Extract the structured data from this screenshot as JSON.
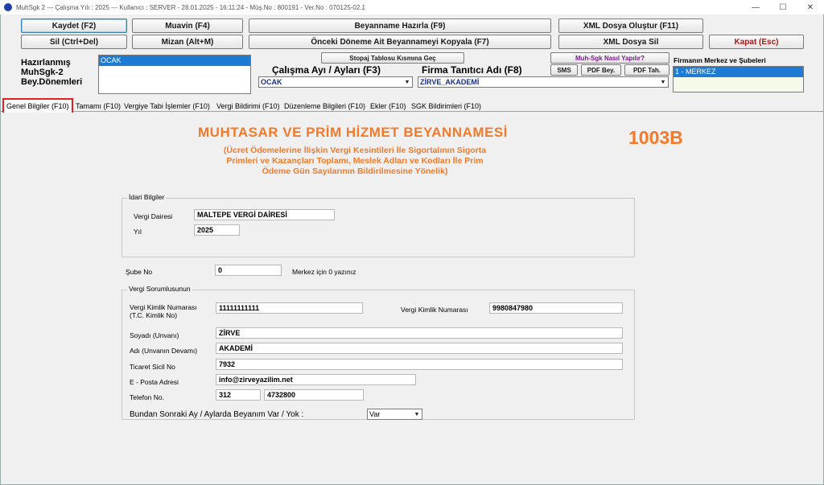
{
  "window": {
    "title": "MuhSgk 2  ---  Çalışma Yılı : 2025  ---  Kullanıcı : SERVER - 28.01.2025 - 16:11:24 - Müş.No : 800191 - Ver.No : 070125-02.1"
  },
  "toolbar": {
    "kaydet": "Kaydet (F2)",
    "muavin": "Muavin (F4)",
    "beyanname_hazirla": "Beyanname Hazırla (F9)",
    "xml_olustur": "XML Dosya Oluştur (F11)",
    "sil": "Sil (Ctrl+Del)",
    "mizan": "Mizan (Alt+M)",
    "onceki_kopyala": "Önceki Döneme Ait Beyannameyi Kopyala (F7)",
    "xml_sil": "XML Dosya Sil",
    "kapat": "Kapat (Esc)",
    "stopaj": "Stopaj Tablosu Kısmına Geç",
    "muh_sgk": "Muh-Sgk Nasıl Yapılır?",
    "sms": "SMS",
    "pdf_bey": "PDF Bey.",
    "pdf_tah": "PDF Tah."
  },
  "left": {
    "line1": "Hazırlanmış",
    "line2": "MuhSgk-2",
    "line3": "Bey.Dönemleri",
    "period_selected": "OCAK"
  },
  "calisma": {
    "label": "Çalışma Ayı / Ayları (F3)",
    "value": "OCAK"
  },
  "firma": {
    "label": "Firma Tanıtıcı Adı (F8)",
    "value": "ZİRVE_AKADEMİ"
  },
  "subeler": {
    "label": "Firmanın Merkez ve Şubeleri",
    "selected": "1 - MERKEZ"
  },
  "tabs": [
    "Genel Bilgiler (F10)",
    "Tamamı (F10)",
    "Vergiye Tabi İşlemler (F10)",
    "Vergi Bildirimi (F10)",
    "Düzenleme Bilgileri (F10)",
    "Ekler (F10)",
    "SGK Bildirimleri (F10)"
  ],
  "form": {
    "title": "MUHTASAR VE PRİM HİZMET BEYANNAMESİ",
    "subtitle_1": "(Ücret Ödemelerine İlişkin Vergi Kesintileri İle Sigortalının Sigorta",
    "subtitle_2": "Primleri ve Kazançları Toplamı, Meslek Adları ve Kodları İle Prim",
    "subtitle_3": "Ödeme Gün Sayılarının Bildirilmesine Yönelik)",
    "code": "1003B",
    "idari": {
      "legend": "İdari Bilgiler",
      "vergi_dairesi_label": "Vergi Dairesi",
      "vergi_dairesi": "MALTEPE VERGİ DAİRESİ",
      "yil_label": "Yıl",
      "yil": "2025"
    },
    "sube": {
      "label": "Şube No",
      "value": "0",
      "hint": "Merkez için 0 yazınız"
    },
    "sorumlu": {
      "legend": "Vergi Sorumlusunun",
      "tckn_label_1": "Vergi Kimlik Numarası",
      "tckn_label_2": "(T.C. Kimlik No)",
      "tckn": "11111111111",
      "vkn_label": "Vergi Kimlik Numarası",
      "vkn": "9980847980",
      "soyadi_label": "Soyadı (Unvanı)",
      "soyadi": "ZİRVE",
      "adi_label": "Adı (Unvanın Devamı)",
      "adi": "AKADEMİ",
      "sicil_label": "Ticaret Sicil No",
      "sicil": "7932",
      "eposta_label": "E - Posta Adresi",
      "eposta": "info@zirveyazilim.net",
      "telefon_label": "Telefon No.",
      "tel_kod": "312",
      "tel_no": "4732800"
    },
    "sonraki": {
      "label": "Bundan Sonraki Ay / Aylarda Beyanım Var / Yok :",
      "value": "Var"
    }
  }
}
